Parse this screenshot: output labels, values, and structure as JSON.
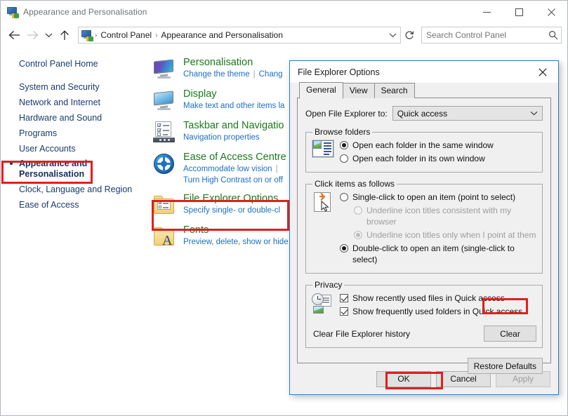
{
  "window": {
    "title": "Appearance and Personalisation",
    "icon": "control-panel-icon",
    "controls": {
      "minimize": "Minimise",
      "maximize": "Maximise",
      "close": "Close"
    }
  },
  "addressbar": {
    "back": "Back",
    "forward": "Forward",
    "recent": "Recent locations",
    "up": "Up one level",
    "breadcrumbs": [
      "Control Panel",
      "Appearance and Personalisation"
    ],
    "separator": "›",
    "dropdown": "Previous locations",
    "refresh": "Refresh"
  },
  "search": {
    "placeholder": "Search Control Panel",
    "value": "",
    "icon": "search-icon"
  },
  "sidebar": {
    "home": "Control Panel Home",
    "items": [
      {
        "label": "System and Security",
        "selected": false
      },
      {
        "label": "Network and Internet",
        "selected": false
      },
      {
        "label": "Hardware and Sound",
        "selected": false
      },
      {
        "label": "Programs",
        "selected": false
      },
      {
        "label": "User Accounts",
        "selected": false
      },
      {
        "label": "Appearance and Personalisation",
        "selected": true
      },
      {
        "label": "Clock, Language and Region",
        "selected": false
      },
      {
        "label": "Ease of Access",
        "selected": false
      }
    ]
  },
  "content": {
    "categories": [
      {
        "icon": "monitor-personalisation-icon",
        "title": "Personalisation",
        "links": [
          "Change the theme",
          "Chang"
        ]
      },
      {
        "icon": "monitor-display-icon",
        "title": "Display",
        "links": [
          "Make text and other items la"
        ]
      },
      {
        "icon": "taskbar-navigation-icon",
        "title": "Taskbar and Navigatio",
        "links": [
          "Navigation properties"
        ]
      },
      {
        "icon": "ease-of-access-icon",
        "title": "Ease of Access Centre",
        "links": [
          "Accommodate low vision",
          "Turn High Contrast on or off"
        ]
      },
      {
        "icon": "file-explorer-options-icon",
        "title": "File Explorer Options",
        "links": [
          "Specify single- or double-cl"
        ]
      },
      {
        "icon": "fonts-icon",
        "title": "Fonts",
        "links": [
          "Preview, delete, show or hide"
        ]
      }
    ]
  },
  "dialog": {
    "title": "File Explorer Options",
    "close": "Close",
    "tabs": [
      {
        "label": "General",
        "active": true
      },
      {
        "label": "View",
        "active": false
      },
      {
        "label": "Search",
        "active": false
      }
    ],
    "open_to": {
      "label": "Open File Explorer to:",
      "value": "Quick access",
      "arrow": "⌄"
    },
    "browse_folders": {
      "legend": "Browse folders",
      "icon": "browse-folders-icon",
      "options": [
        {
          "label": "Open each folder in the same window",
          "selected": true
        },
        {
          "label": "Open each folder in its own window",
          "selected": false
        }
      ]
    },
    "click_items": {
      "legend": "Click items as follows",
      "icon": "click-items-icon",
      "options": [
        {
          "label": "Single-click to open an item (point to select)",
          "selected": false,
          "disabled": false,
          "indent": false
        },
        {
          "label": "Underline icon titles consistent with my browser",
          "selected": false,
          "disabled": true,
          "indent": true
        },
        {
          "label": "Underline icon titles only when I point at them",
          "selected": true,
          "disabled": true,
          "indent": true
        },
        {
          "label": "Double-click to open an item (single-click to select)",
          "selected": true,
          "disabled": false,
          "indent": false
        }
      ]
    },
    "privacy": {
      "legend": "Privacy",
      "icon": "privacy-history-icon",
      "checkboxes": [
        {
          "label": "Show recently used files in Quick access",
          "checked": true
        },
        {
          "label": "Show frequently used folders in Quick access",
          "checked": true
        }
      ],
      "clear_label": "Clear File Explorer history",
      "clear_button": "Clear"
    },
    "restore_defaults": "Restore Defaults",
    "footer": {
      "ok": "OK",
      "cancel": "Cancel",
      "apply": "Apply",
      "apply_disabled": true
    }
  },
  "annotations": {
    "highlight_color": "#e01f1f",
    "boxes": [
      "sidebar-appearance-and-personalisation",
      "content-file-explorer-options",
      "dialog-clear-button",
      "dialog-ok-button"
    ]
  }
}
